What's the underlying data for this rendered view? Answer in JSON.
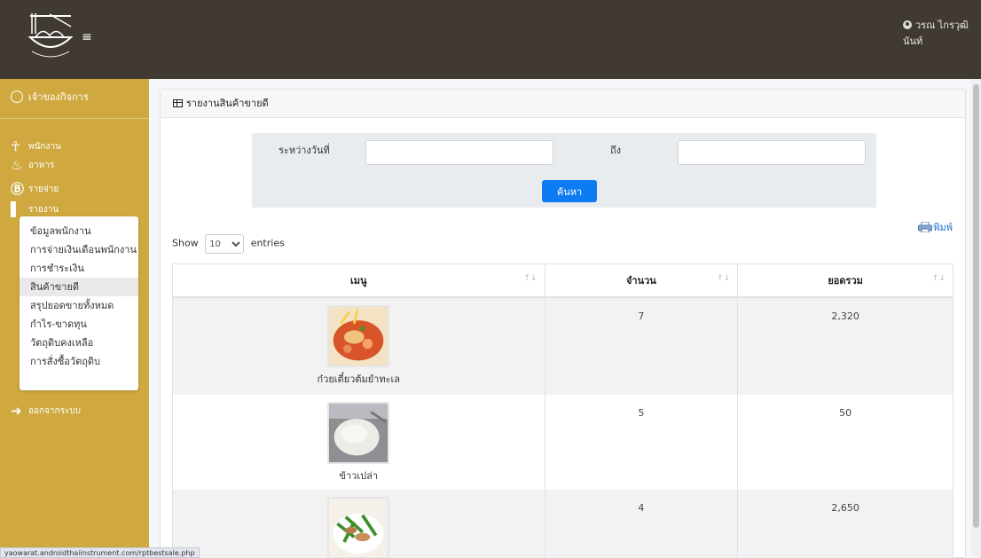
{
  "user": {
    "name_line1": "วรณ ไกรวุฒิ",
    "name_line2": "นันท์"
  },
  "sidebar": {
    "owner": "เจ้าของกิจการ",
    "items": [
      {
        "label": "พนักงาน",
        "icon": "person-icon"
      },
      {
        "label": "อาหาร",
        "icon": "food-icon"
      },
      {
        "label": "รายจ่าย",
        "icon": "baht-icon"
      },
      {
        "label": "รายงาน",
        "icon": "bar-chart-icon"
      }
    ],
    "submenu": [
      "ข้อมูลพนักงาน",
      "การจ่ายเงินเดือนพนักงาน",
      "การชำระเงิน",
      "สินค้าขายดี",
      "สรุปยอดขายทั้งหมด",
      "กำไร-ขาดทุน",
      "วัตถุดิบคงเหลือ",
      "การสั่งซื้อวัตถุดิบ"
    ],
    "logout": "ออกจากระบบ"
  },
  "card": {
    "title": "รายงานสินค้าขายดี"
  },
  "filter": {
    "from_label": "ระหว่างวันที่",
    "to_label": "ถึง",
    "from_value": "",
    "to_value": "",
    "search_label": "ค้นหา"
  },
  "print_label": "พิมพ์",
  "show": {
    "prefix": "Show",
    "value": "10",
    "suffix": "entries"
  },
  "table": {
    "headers": [
      "เมนู",
      "จำนวน",
      "ยอดรวม"
    ],
    "rows": [
      {
        "menu": "ก๋วยเตี๋ยวต้มยำทะเล",
        "qty": "7",
        "total": "2,320"
      },
      {
        "menu": "ข้าวเปล่า",
        "qty": "5",
        "total": "50"
      },
      {
        "menu": "",
        "qty": "4",
        "total": "2,650"
      }
    ]
  },
  "status_url": "yaowarat.androidthaiinstrument.com/rptbestsale.php",
  "colors": {
    "navbar": "#403a33",
    "sidebar": "#cfa93f",
    "button": "#0d7cf2"
  }
}
